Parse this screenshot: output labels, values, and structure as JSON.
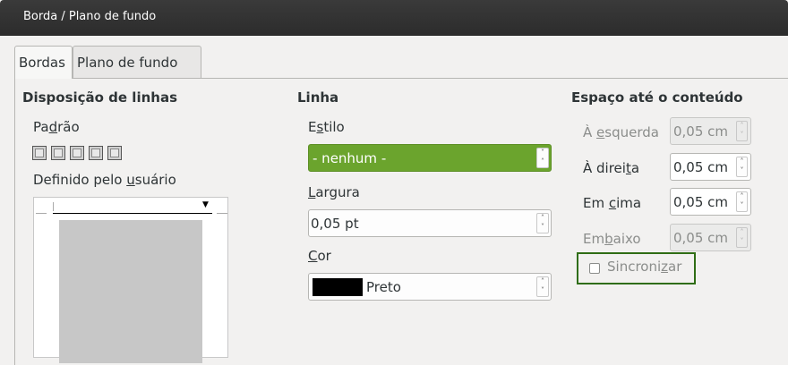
{
  "window": {
    "title": "Borda / Plano de fundo"
  },
  "tabs": [
    {
      "label": "Bordas",
      "active": true
    },
    {
      "label": "Plano de fundo",
      "active": false
    }
  ],
  "line_arrangement": {
    "heading": "Disposição de linhas",
    "default_label_pre": "Pa",
    "default_label_key": "d",
    "default_label_post": "rão",
    "user_defined_pre": "Definido pelo ",
    "user_defined_key": "u",
    "user_defined_post": "suário",
    "preset_count": 5
  },
  "line": {
    "heading": "Linha",
    "style_label_pre": "E",
    "style_label_key": "s",
    "style_label_post": "tilo",
    "style_value": "- nenhum -",
    "width_label_key": "L",
    "width_label_post": "argura",
    "width_value": "0,05 pt",
    "color_label_key": "C",
    "color_label_post": "or",
    "color_value": "Preto",
    "color_swatch": "#000000"
  },
  "spacing": {
    "heading": "Espaço até o conteúdo",
    "left_pre": "À ",
    "left_key": "e",
    "left_post": "squerda",
    "left_value": "0,05 cm",
    "right_pre": "À direi",
    "right_key": "t",
    "right_post": "a",
    "right_value": "0,05 cm",
    "top_pre": "Em ",
    "top_key": "c",
    "top_post": "ima",
    "top_value": "0,05 cm",
    "bottom_pre": "Em",
    "bottom_key": "b",
    "bottom_post": "aixo",
    "bottom_value": "0,05 cm",
    "sync_pre": "Sincroni",
    "sync_key": "z",
    "sync_post": "ar",
    "sync_checked": false
  },
  "colors": {
    "accent": "#6ba42d",
    "focus_outline": "#2f6d15",
    "titlebar": "#2c2c2c"
  }
}
